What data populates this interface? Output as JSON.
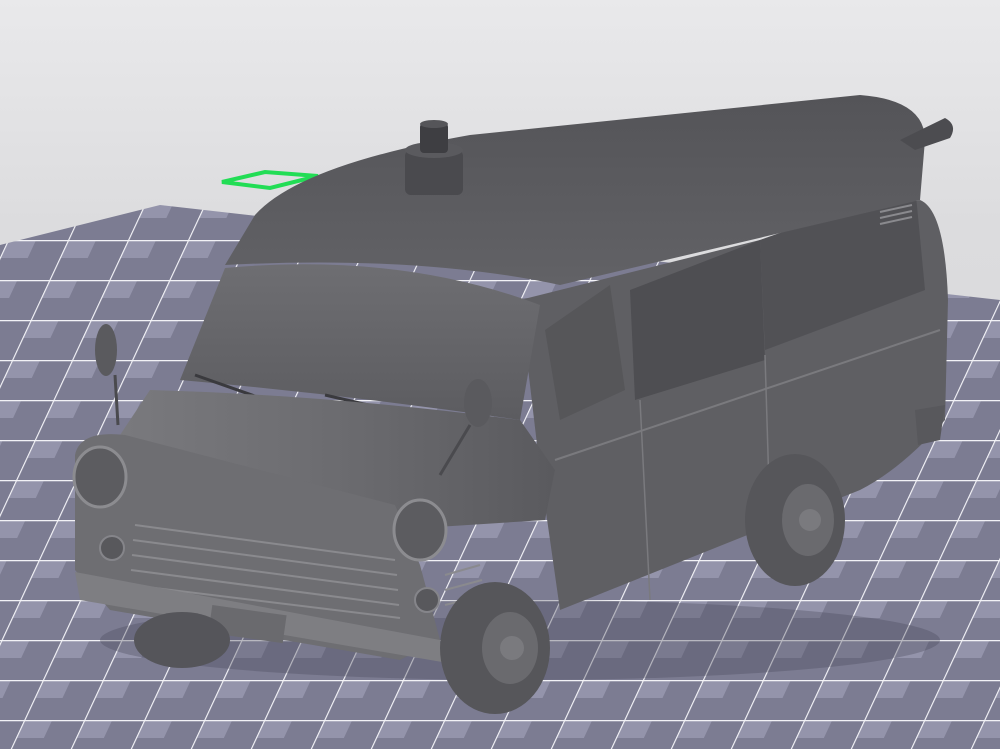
{
  "viewport": {
    "bed_label": "",
    "model": "ambulance-van",
    "colors": {
      "background": "#dcdcde",
      "bed_tile_dark": "#6f6f86",
      "bed_tile_light": "#9696ac",
      "bed_grid_line": "#ffffff",
      "model_body": "#6a6a6e",
      "model_roof": "#5e5e62",
      "axis_gizmo": "#22dd55"
    },
    "icons": [
      "axis-gizmo-icon"
    ]
  }
}
